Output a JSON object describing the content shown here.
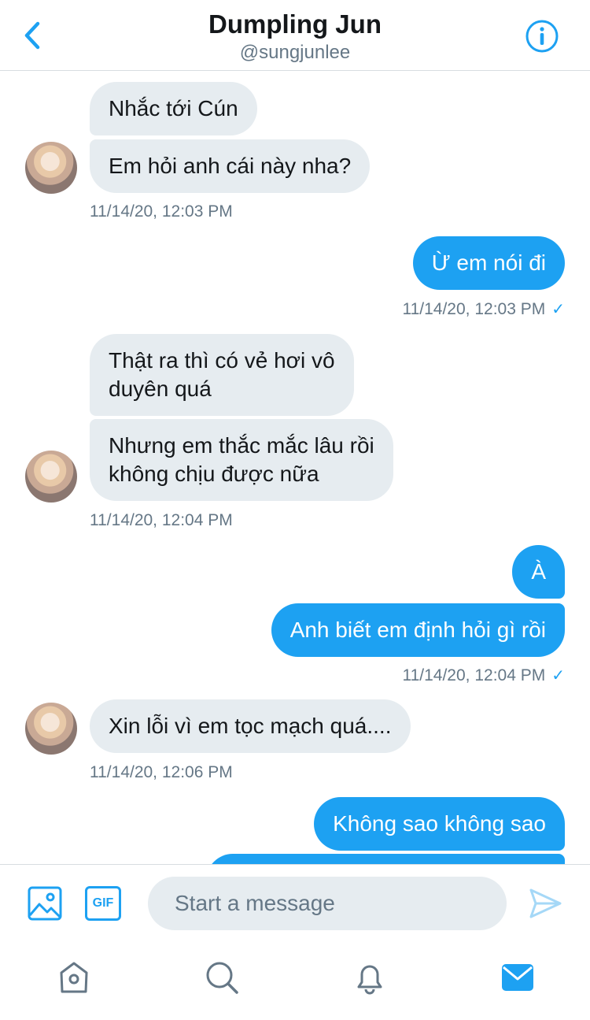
{
  "header": {
    "title": "Dumpling Jun",
    "handle": "@sungjunlee"
  },
  "messages": [
    {
      "dir": "in",
      "text": "Nhắc tới Cún"
    },
    {
      "dir": "in",
      "text": "Em hỏi anh cái này nha?"
    },
    {
      "dir": "in",
      "timestamp": "11/14/20, 12:03 PM"
    },
    {
      "dir": "out",
      "text": "Ừ em nói đi"
    },
    {
      "dir": "out",
      "timestamp": "11/14/20, 12:03 PM",
      "read": "✓"
    },
    {
      "dir": "in",
      "text_lines": [
        "Thật ra thì có vẻ hơi vô",
        "duyên quá"
      ]
    },
    {
      "dir": "in",
      "text_lines": [
        "Nhưng em thắc mắc lâu rồi",
        "không chịu được nữa"
      ]
    },
    {
      "dir": "in",
      "timestamp": "11/14/20, 12:04 PM"
    },
    {
      "dir": "out",
      "text": "À"
    },
    {
      "dir": "out",
      "text": "Anh biết em định hỏi gì rồi"
    },
    {
      "dir": "out",
      "timestamp": "11/14/20, 12:04 PM",
      "read": "✓"
    },
    {
      "dir": "in",
      "text": "Xin lỗi vì em tọc mạch quá...."
    },
    {
      "dir": "in",
      "timestamp": "11/14/20, 12:06 PM"
    },
    {
      "dir": "out",
      "text": "Không sao không sao"
    }
  ],
  "composer": {
    "gif_label": "GIF",
    "placeholder": "Start a message"
  },
  "icons": {
    "back": "chevron-left-icon",
    "info": "info-icon",
    "media": "image-icon",
    "send": "send-icon",
    "tabs": [
      "home-icon",
      "search-icon",
      "notifications-icon",
      "messages-icon"
    ]
  },
  "colors": {
    "accent": "#1da1f2",
    "incoming_bubble": "#e6ecf0",
    "secondary_text": "#657786"
  }
}
